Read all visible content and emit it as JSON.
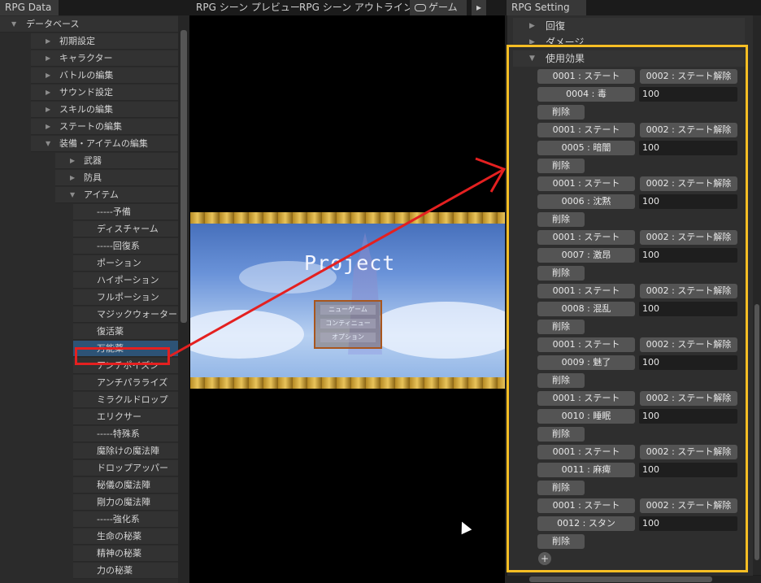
{
  "tabs": {
    "left_title": "RPG Data",
    "scene_preview": "RPG シーン プレビュー",
    "scene_outline": "RPG シーン アウトライン*",
    "game": "ゲーム",
    "right_title": "RPG Setting",
    "more_icon": "▸"
  },
  "tree": {
    "root": "データベース",
    "items": [
      "初期設定",
      "キャラクター",
      "バトルの編集",
      "サウンド設定",
      "スキルの編集",
      "ステートの編集",
      "装備・アイテムの編集",
      "武器",
      "防具",
      "アイテム",
      "-----予備",
      "ディスチャーム",
      "-----回復系",
      "ポーション",
      "ハイポーション",
      "フルポーション",
      "マジックウォーター",
      "復活薬",
      "万能薬",
      "アンチポイズン",
      "アンチパラライズ",
      "ミラクルドロップ",
      "エリクサー",
      "-----特殊系",
      "魔除けの魔法陣",
      "ドロップアッパー",
      "秘儀の魔法陣",
      "剛力の魔法陣",
      "-----強化系",
      "生命の秘薬",
      "精神の秘薬",
      "力の秘薬"
    ]
  },
  "game": {
    "title": "Project",
    "menu": [
      "ニューゲーム",
      "コンティニュー",
      "オプション"
    ]
  },
  "settings": {
    "section_recover": "回復",
    "section_damage": "ダメージ",
    "section_effect": "使用効果",
    "add_label": "+",
    "effects": [
      {
        "type_state": "0001 : ステート",
        "type_release": "0002 : ステート解除",
        "state": "0004 : 毒",
        "value": "100",
        "delete": "削除"
      },
      {
        "type_state": "0001 : ステート",
        "type_release": "0002 : ステート解除",
        "state": "0005 : 暗闇",
        "value": "100",
        "delete": "削除"
      },
      {
        "type_state": "0001 : ステート",
        "type_release": "0002 : ステート解除",
        "state": "0006 : 沈黙",
        "value": "100",
        "delete": "削除"
      },
      {
        "type_state": "0001 : ステート",
        "type_release": "0002 : ステート解除",
        "state": "0007 : 激昂",
        "value": "100",
        "delete": "削除"
      },
      {
        "type_state": "0001 : ステート",
        "type_release": "0002 : ステート解除",
        "state": "0008 : 混乱",
        "value": "100",
        "delete": "削除"
      },
      {
        "type_state": "0001 : ステート",
        "type_release": "0002 : ステート解除",
        "state": "0009 : 魅了",
        "value": "100",
        "delete": "削除"
      },
      {
        "type_state": "0001 : ステート",
        "type_release": "0002 : ステート解除",
        "state": "0010 : 睡眠",
        "value": "100",
        "delete": "削除"
      },
      {
        "type_state": "0001 : ステート",
        "type_release": "0002 : ステート解除",
        "state": "0011 : 麻痺",
        "value": "100",
        "delete": "削除"
      },
      {
        "type_state": "0001 : ステート",
        "type_release": "0002 : ステート解除",
        "state": "0012 : スタン",
        "value": "100",
        "delete": "削除"
      }
    ]
  },
  "colors": {
    "highlight_yellow": "#f7be24",
    "highlight_red": "#e42020",
    "selection": "#2d5376"
  }
}
